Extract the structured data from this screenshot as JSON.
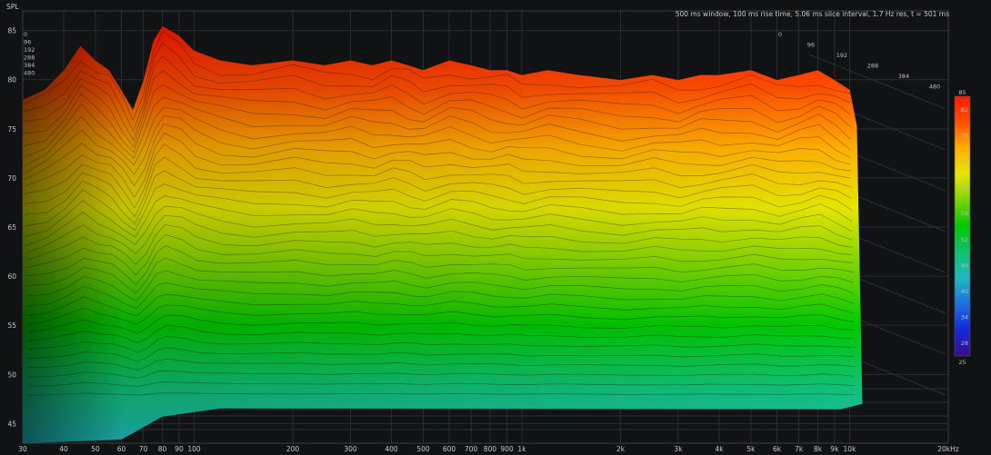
{
  "chart_data": {
    "type": "area",
    "title": "500 ms window, 100 ms rise time, 5.06 ms slice interval, 1.7 Hz res, t = 501 ms",
    "ylabel": "SPL",
    "y_ticks": [
      "85",
      "80",
      "75",
      "70",
      "65",
      "60",
      "55",
      "50",
      "45"
    ],
    "ylim": [
      43,
      87
    ],
    "x_scale": "log",
    "xlim": [
      30,
      20000
    ],
    "x_ticks": [
      {
        "value": 30,
        "label": "30"
      },
      {
        "value": 40,
        "label": "40"
      },
      {
        "value": 50,
        "label": "50"
      },
      {
        "value": 60,
        "label": "60"
      },
      {
        "value": 70,
        "label": "70"
      },
      {
        "value": 80,
        "label": "80"
      },
      {
        "value": 90,
        "label": "90"
      },
      {
        "value": 100,
        "label": "100"
      },
      {
        "value": 200,
        "label": "200"
      },
      {
        "value": 300,
        "label": "300"
      },
      {
        "value": 400,
        "label": "400"
      },
      {
        "value": 500,
        "label": "500"
      },
      {
        "value": 600,
        "label": "600"
      },
      {
        "value": 700,
        "label": "700"
      },
      {
        "value": 800,
        "label": "800"
      },
      {
        "value": 900,
        "label": "900"
      },
      {
        "value": 1000,
        "label": "1k"
      },
      {
        "value": 2000,
        "label": "2k"
      },
      {
        "value": 3000,
        "label": "3k"
      },
      {
        "value": 4000,
        "label": "4k"
      },
      {
        "value": 5000,
        "label": "5k"
      },
      {
        "value": 6000,
        "label": "6k"
      },
      {
        "value": 7000,
        "label": "7k"
      },
      {
        "value": 8000,
        "label": "8k"
      },
      {
        "value": 9000,
        "label": "9k"
      },
      {
        "value": 10000,
        "label": "10k"
      },
      {
        "value": 20000,
        "label": "20kHz"
      }
    ],
    "time_labels": [
      "0",
      "96",
      "192",
      "288",
      "384",
      "480"
    ],
    "colorbar": {
      "min": 25,
      "max": 85,
      "ticks": [
        "82",
        "76",
        "70",
        "64",
        "58",
        "52",
        "46",
        "40",
        "34",
        "28"
      ],
      "min_label": "25",
      "max_label": "85",
      "colors": [
        "#3b0a8c",
        "#1428d8",
        "#1e6fe0",
        "#1fb8c0",
        "#10c070",
        "#00c800",
        "#7ad400",
        "#e6e600",
        "#ffb000",
        "#ff5000",
        "#ff1a00"
      ]
    },
    "front_slice": {
      "x": [
        30,
        35,
        40,
        45,
        50,
        55,
        60,
        65,
        70,
        75,
        80,
        90,
        100,
        120,
        150,
        200,
        250,
        300,
        350,
        400,
        450,
        500,
        600,
        700,
        800,
        900,
        1000,
        1200,
        1500,
        2000,
        2500,
        3000,
        3500,
        4000,
        5000,
        6000,
        7000,
        8000,
        9000,
        10000
      ],
      "spl": [
        78,
        79,
        81,
        83.5,
        82,
        81,
        79,
        77,
        80,
        84,
        85.5,
        84.5,
        83,
        82,
        81.5,
        82,
        81.5,
        82,
        81.5,
        82,
        81.5,
        81,
        82,
        81.5,
        81,
        81,
        80.5,
        81,
        80.5,
        80,
        80.5,
        80,
        80.5,
        80.5,
        81,
        80,
        80.5,
        81,
        80,
        79
      ]
    },
    "last_slice_spl": 47
  }
}
